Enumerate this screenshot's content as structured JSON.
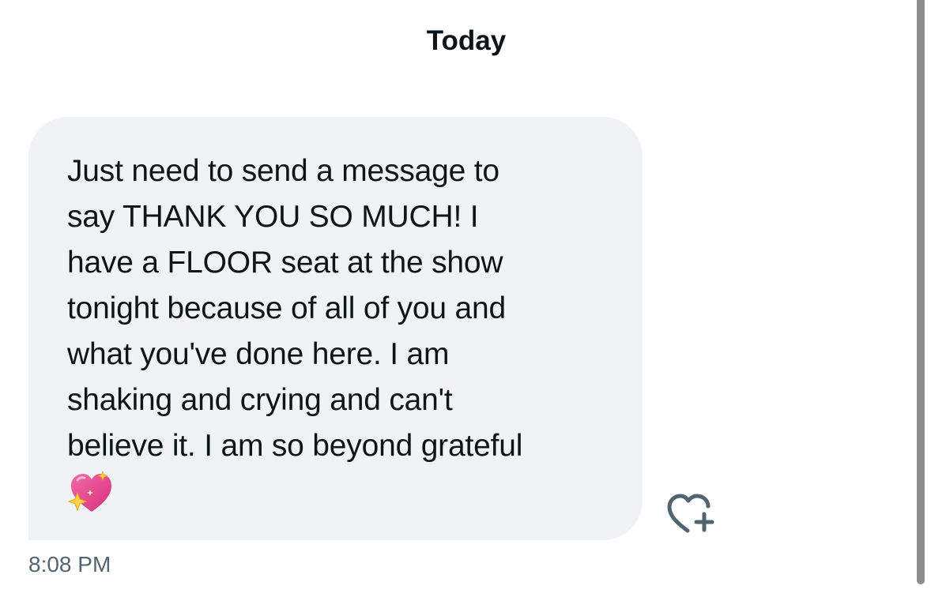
{
  "conversation": {
    "date_header": "Today",
    "messages": [
      {
        "text": "Just need to send a message to\nsay THANK YOU SO MUCH! I\nhave a FLOOR seat at the show\ntonight because of all of you and\nwhat you've done here. I am\nshaking and crying and can't\nbelieve it. I am so beyond grateful",
        "emoji": "sparkling-heart",
        "timestamp": "8:08 PM"
      }
    ]
  },
  "icons": {
    "react": "heart-plus-icon",
    "emoji": "sparkling-heart-icon"
  },
  "colors": {
    "bubble_background": "#eff3f4",
    "text": "#0f1419",
    "secondary_text": "#536471",
    "icon": "#536471",
    "emoji_heart": "#e8418c",
    "emoji_sparkle": "#fbd44a",
    "scrollbar": "#8e8e8e"
  }
}
